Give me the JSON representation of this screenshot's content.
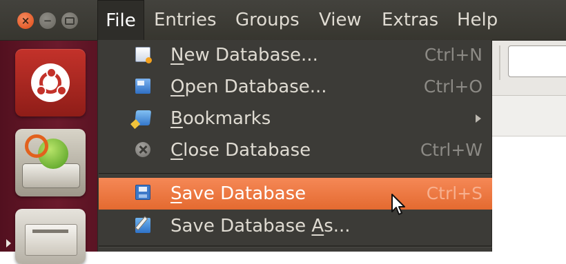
{
  "window_controls": {
    "close_glyph": "×",
    "minimize_glyph": "−",
    "maximize_glyph": ""
  },
  "menubar": {
    "items": [
      "File",
      "Entries",
      "Groups",
      "View",
      "Extras",
      "Help"
    ],
    "active": "File"
  },
  "launcher": {
    "icons": [
      "ubuntu-dash-icon",
      "update-manager-icon",
      "file-cabinet-icon"
    ]
  },
  "file_menu": {
    "items": [
      {
        "mnemonic": "N",
        "rest": "ew Database...",
        "shortcut": "Ctrl+N",
        "icon": "new-database-icon"
      },
      {
        "mnemonic": "O",
        "rest": "pen Database...",
        "shortcut": "Ctrl+O",
        "icon": "open-database-icon"
      },
      {
        "mnemonic": "B",
        "rest": "ookmarks",
        "shortcut": "",
        "icon": "bookmarks-icon",
        "submenu": true
      },
      {
        "mnemonic": "C",
        "rest": "lose Database",
        "shortcut": "Ctrl+W",
        "icon": "close-database-icon"
      },
      {
        "mnemonic": "S",
        "rest": "ave Database",
        "shortcut": "Ctrl+S",
        "icon": "save-database-icon",
        "highlighted": true
      },
      {
        "prefix": "Save Database ",
        "mnemonic": "A",
        "rest": "s...",
        "shortcut": "",
        "icon": "save-as-icon"
      }
    ]
  },
  "colors": {
    "menubar_bg": "#3c3b37",
    "menu_text": "#dfdbd2",
    "highlight": "#f07746",
    "launcher_bg": "#5e1424",
    "shortcut_text": "#8c8a85"
  }
}
